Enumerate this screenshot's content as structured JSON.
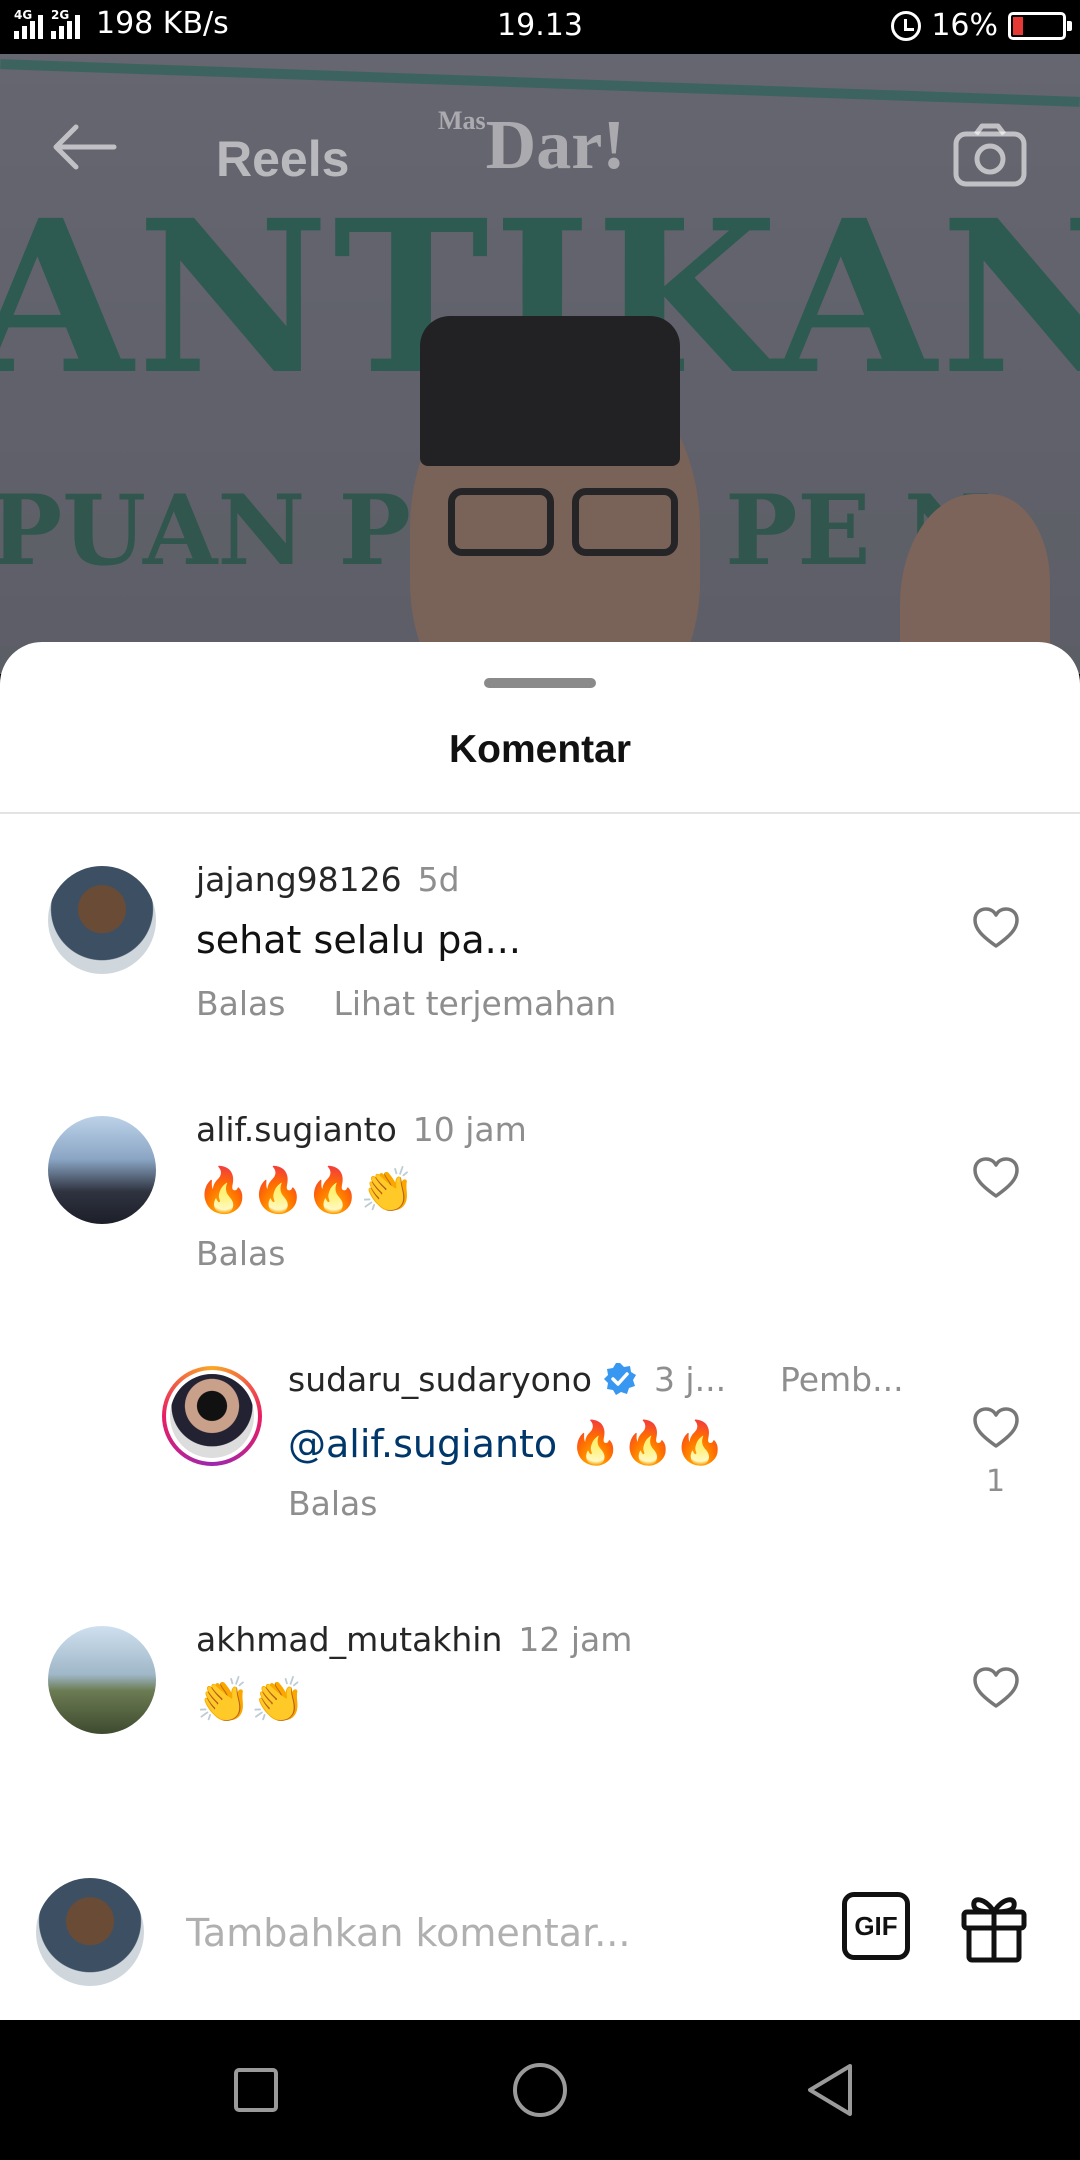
{
  "status_bar": {
    "network_1": "4G",
    "network_2": "2G",
    "speed": "198 KB/s",
    "time": "19.13",
    "battery": "16%",
    "battery_color": "#e53935"
  },
  "video": {
    "screen_title": "Reels",
    "watermark_small": "Mas",
    "watermark": "Dar!",
    "banner_big": "ANTIKAN",
    "banner_small": "PUAN PE   UH PE N"
  },
  "sheet": {
    "title": "Komentar"
  },
  "comments": [
    {
      "username": "jajang98126",
      "age": "5d",
      "text": "sehat selalu pa...",
      "reply_label": "Balas",
      "translate_label": "Lihat terjemahan"
    },
    {
      "username": "alif.sugianto",
      "age": "10 jam",
      "text": "🔥🔥🔥👏",
      "reply_label": "Balas"
    },
    {
      "username": "sudaru_sudaryono",
      "verified": true,
      "age": "3 j...",
      "pinned_by": "Pemb...",
      "mention": "@alif.sugianto",
      "text": "🔥🔥🔥",
      "reply_label": "Balas",
      "likes": "1"
    },
    {
      "username": "akhmad_mutakhin",
      "age": "12 jam",
      "text": "👏👏"
    }
  ],
  "emoji_bar": [
    "❤",
    "🙌",
    "🔥",
    "👏",
    "😢",
    "😍",
    "😮",
    "😁"
  ],
  "input": {
    "placeholder": "Tambahkan komentar...",
    "gif_label": "GIF"
  },
  "colors": {
    "heart": "#e0427a",
    "mention": "#00376b",
    "verified": "#3897f0"
  }
}
